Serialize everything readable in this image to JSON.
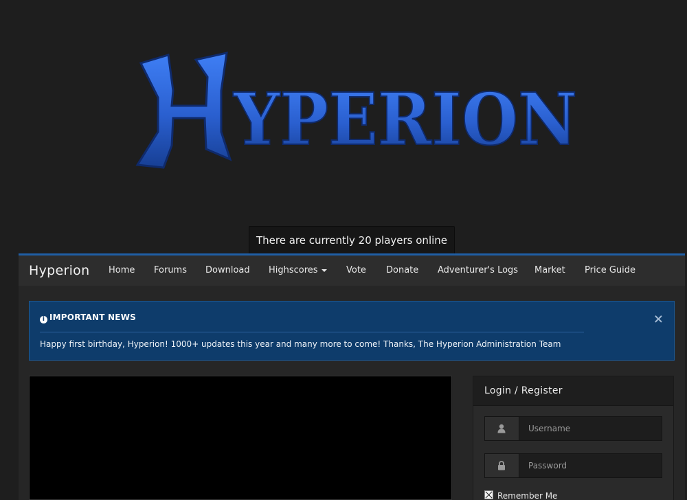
{
  "logo": {
    "text": "Hyperion"
  },
  "online_banner": "There are currently 20 players online",
  "navbar": {
    "brand": "Hyperion",
    "items": [
      "Home",
      "Forums",
      "Download",
      "Highscores",
      "Vote",
      "Donate",
      "Adventurer's Logs",
      "Market",
      "Price Guide"
    ]
  },
  "news": {
    "heading": "IMPORTANT NEWS",
    "message": "Happy first birthday, Hyperion! 1000+ updates this year and many more to come! Thanks, The Hyperion Administration Team",
    "close": "×"
  },
  "login": {
    "title": "Login / Register",
    "username_placeholder": "Username",
    "password_placeholder": "Password",
    "remember_label": "Remember Me"
  },
  "colors": {
    "accent": "#1f5fa6",
    "news_bg": "#0e3c6b",
    "logo_blue": "#2f6fe0"
  },
  "icons": [
    "info-icon",
    "close-icon",
    "user-icon",
    "lock-icon",
    "caret-down-icon",
    "checkbox-icon"
  ]
}
